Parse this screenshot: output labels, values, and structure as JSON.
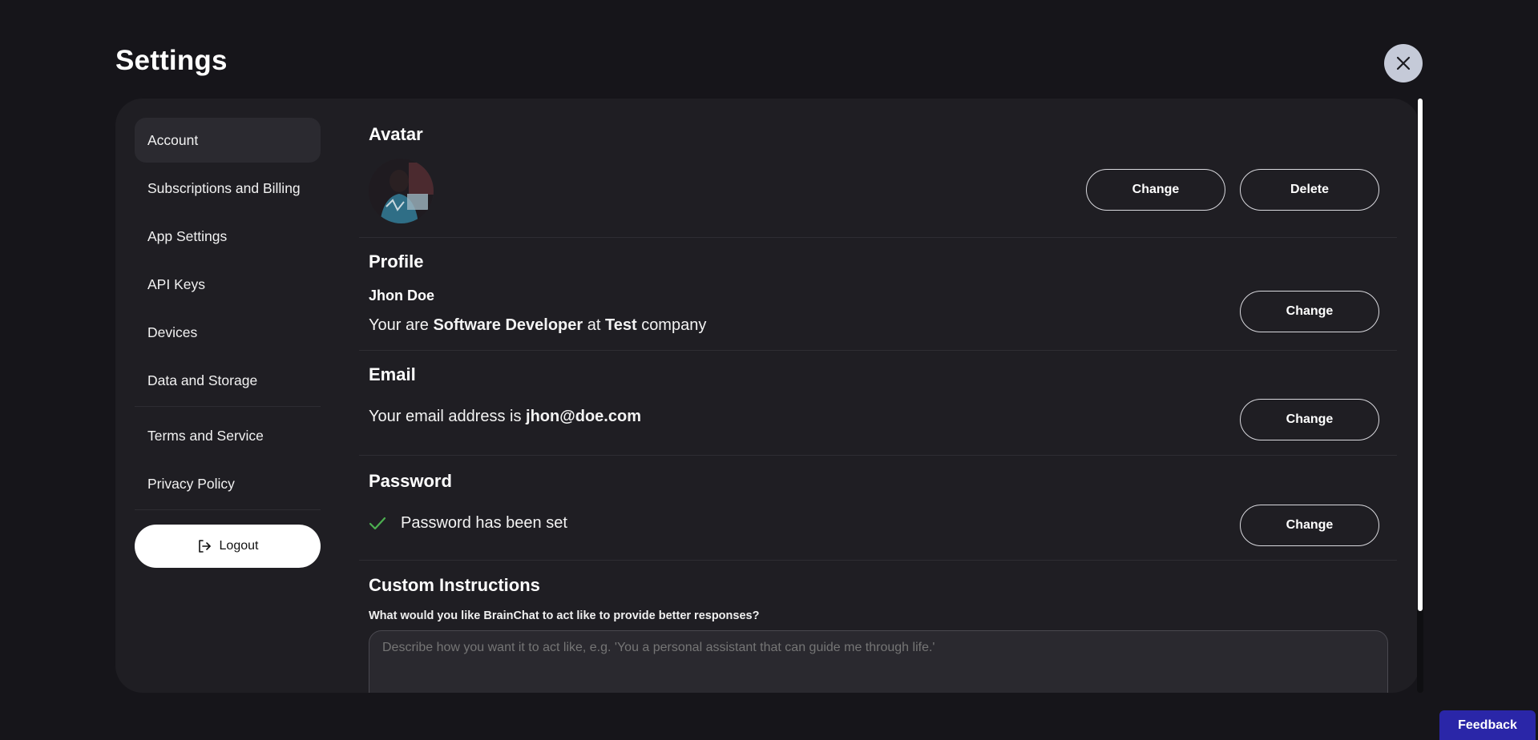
{
  "page": {
    "title": "Settings"
  },
  "sidebar": {
    "items": [
      {
        "label": "Account"
      },
      {
        "label": "Subscriptions and Billing"
      },
      {
        "label": "App Settings"
      },
      {
        "label": "API Keys"
      },
      {
        "label": "Devices"
      },
      {
        "label": "Data and Storage"
      },
      {
        "label": "Terms and Service"
      },
      {
        "label": "Privacy Policy"
      }
    ],
    "logout_label": "Logout"
  },
  "avatar": {
    "heading": "Avatar",
    "change_label": "Change",
    "delete_label": "Delete"
  },
  "profile": {
    "heading": "Profile",
    "name": "Jhon Doe",
    "prefix": "Your are",
    "role": "Software Developer",
    "at": "at",
    "company": "Test",
    "suffix": "company",
    "change_label": "Change"
  },
  "email": {
    "heading": "Email",
    "prefix": "Your email address is",
    "address": "jhon@doe.com",
    "change_label": "Change"
  },
  "password": {
    "heading": "Password",
    "status": "Password has been set",
    "change_label": "Change"
  },
  "custom_instructions": {
    "heading": "Custom Instructions",
    "question": "What would you like BrainChat to act like to provide better responses?",
    "placeholder": "Describe how you want it to act like, e.g. 'You a personal assistant that can guide me through life.'"
  },
  "feedback": {
    "label": "Feedback"
  },
  "colors": {
    "background": "#16151a",
    "panel": "#1f1e23",
    "active_nav": "#2b2a30",
    "check": "#4caf50",
    "feedback": "#2a26a8"
  }
}
